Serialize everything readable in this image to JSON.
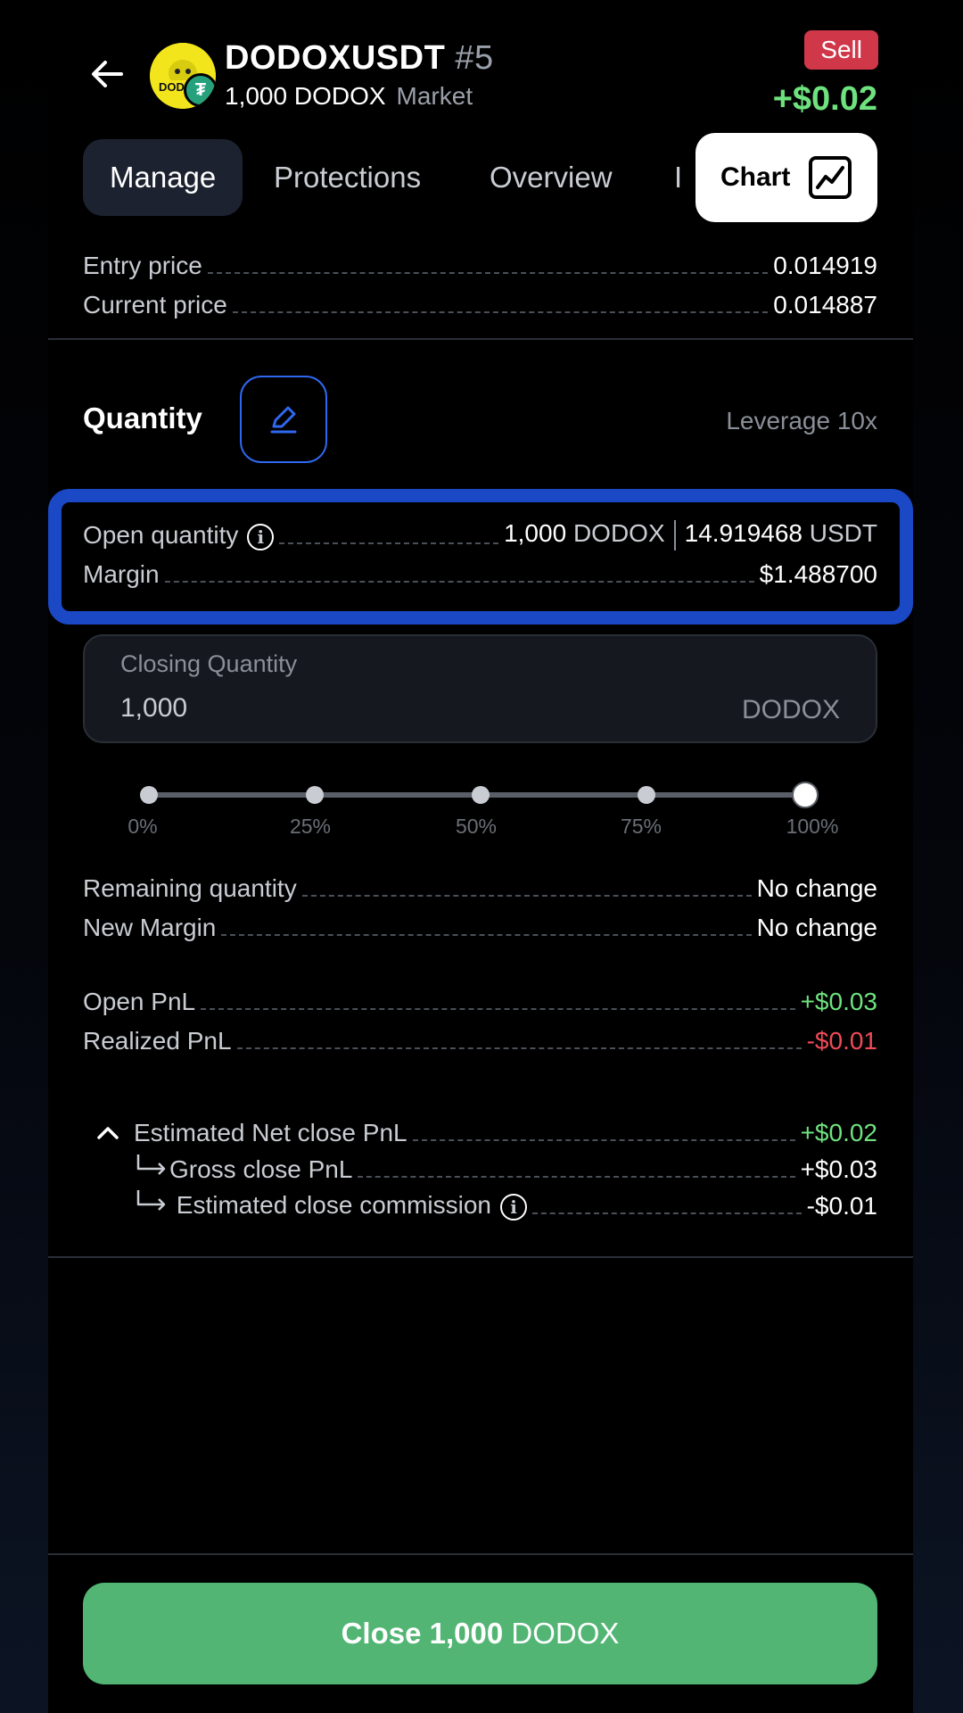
{
  "header": {
    "symbol": "DODOXUSDT",
    "position_number": "#5",
    "size": "1,000 DODOX",
    "order_type": "Market",
    "side": "Sell",
    "pnl": "+$0.02"
  },
  "tabs": [
    "Manage",
    "Protections",
    "Overview",
    "I"
  ],
  "chart_button": "Chart",
  "prices": {
    "entry_label": "Entry price",
    "entry_value": "0.014919",
    "current_label": "Current price",
    "current_value": "0.014887"
  },
  "quantity": {
    "label": "Quantity",
    "leverage": "Leverage 10x"
  },
  "open_quantity": {
    "label": "Open quantity",
    "amount": "1,000",
    "amount_unit": "DODOX",
    "value": "14.919468",
    "value_unit": "USDT"
  },
  "margin": {
    "label": "Margin",
    "value": "$1.488700"
  },
  "closing_quantity": {
    "caption": "Closing Quantity",
    "value": "1,000",
    "unit": "DODOX"
  },
  "slider": {
    "labels": [
      "0%",
      "25%",
      "50%",
      "75%",
      "100%"
    ],
    "value_percent": 100
  },
  "after_close": {
    "remaining_label": "Remaining quantity",
    "remaining_value": "No change",
    "new_margin_label": "New Margin",
    "new_margin_value": "No change"
  },
  "pnl": {
    "open_label": "Open PnL",
    "open_value": "+$0.03",
    "realized_label": "Realized PnL",
    "realized_value": "-$0.01",
    "est_net_label": "Estimated Net close PnL",
    "est_net_value": "+$0.02",
    "gross_label": "Gross close PnL",
    "gross_value": "+$0.03",
    "commission_label": "Estimated close commission",
    "commission_value": "-$0.01"
  },
  "close_button": {
    "label": "Close 1,000",
    "unit": "DODOX"
  },
  "colors": {
    "positive": "#6ee27e",
    "negative": "#f04a58",
    "accent": "#2f68f0",
    "close_button": "#52b574",
    "sell_badge": "#d0384a"
  }
}
